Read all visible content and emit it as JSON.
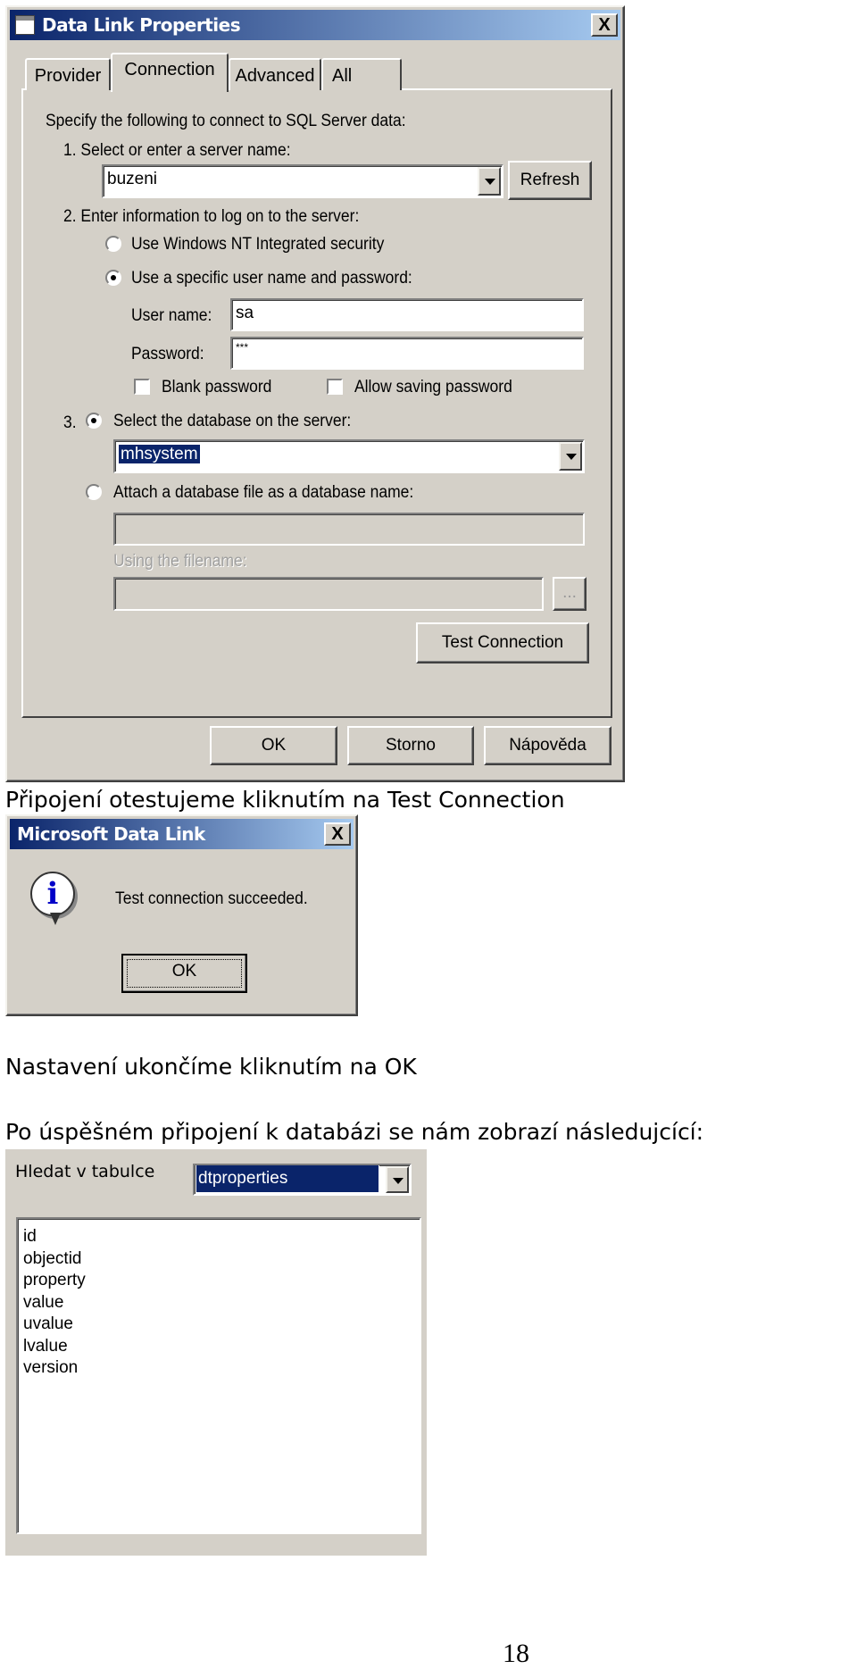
{
  "dialog1": {
    "title": "Data Link Properties",
    "close_label": "X",
    "tabs": [
      {
        "label": "Provider"
      },
      {
        "label": "Connection",
        "active": true
      },
      {
        "label": "Advanced"
      },
      {
        "label": "All"
      }
    ],
    "intro": "Specify the following to connect to SQL Server data:",
    "step1": "1. Select or enter a server name:",
    "server_value": "buzeni",
    "refresh_label": "Refresh",
    "step2": "2. Enter information to log on to the server:",
    "radio_nt": "Use Windows NT Integrated security",
    "radio_specific": "Use a specific user name and password:",
    "username_label": "User name:",
    "username_value": "sa",
    "password_label": "Password:",
    "password_value": "***",
    "blank_password": "Blank password",
    "allow_saving": "Allow saving password",
    "step3": "3.",
    "radio_select_db": "Select the database on the server:",
    "database_value": "mhsystem",
    "radio_attach": "Attach a database file as a database name:",
    "using_filename": "Using the filename:",
    "browse_label": "...",
    "test_connection": "Test Connection",
    "ok": "OK",
    "cancel": "Storno",
    "help": "Nápověda"
  },
  "caption1": "Připojení otestujeme kliknutím na Test Connection",
  "dialog2": {
    "title": "Microsoft Data Link",
    "close_label": "X",
    "message": "Test connection succeeded.",
    "ok": "OK",
    "icon": "info-icon"
  },
  "caption2": "Nastavení ukončíme kliknutím na OK",
  "caption3": "Po úspěšném připojení k databázi se nám zobrazí následujcící:",
  "panel3": {
    "label": "Hledat v tabulce",
    "table_value": "dtproperties",
    "columns": [
      "id",
      "objectid",
      "property",
      "value",
      "uvalue",
      "lvalue",
      "version"
    ]
  },
  "page_number": "18",
  "colors": {
    "dialog_bg": "#d4d0c8",
    "title_start": "#0a246a",
    "title_end": "#a6caf0",
    "selection": "#0a246a"
  }
}
